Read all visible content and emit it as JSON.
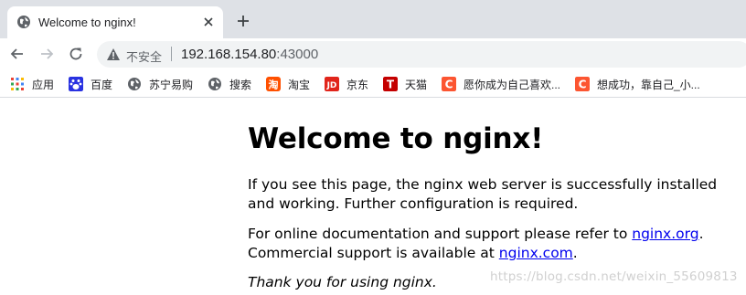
{
  "tab": {
    "title": "Welcome to nginx!"
  },
  "address": {
    "security_label": "不安全",
    "host": "192.168.154.80",
    "port": ":43000"
  },
  "bookmarks": [
    {
      "label": "应用",
      "icon": "apps-grid-icon",
      "color": "#4285f4"
    },
    {
      "label": "百度",
      "icon": "baidu-icon",
      "color": "#2932e1"
    },
    {
      "label": "苏宁易购",
      "icon": "globe-icon",
      "color": "#5f6368"
    },
    {
      "label": "搜索",
      "icon": "globe-icon",
      "color": "#5f6368"
    },
    {
      "label": "淘宝",
      "icon": "taobao-icon",
      "color": "#ff5000"
    },
    {
      "label": "京东",
      "icon": "jd-icon",
      "color": "#e1251b"
    },
    {
      "label": "天猫",
      "icon": "tmall-icon",
      "color": "#c40000"
    },
    {
      "label": "愿你成为自己喜欢...",
      "icon": "csdn-icon",
      "color": "#fc5531"
    },
    {
      "label": "想成功，靠自己_小...",
      "icon": "csdn-icon",
      "color": "#fc5531"
    }
  ],
  "page": {
    "heading": "Welcome to nginx!",
    "p1": "If you see this page, the nginx web server is successfully installed and working. Further configuration is required.",
    "p2_before": "For online documentation and support please refer to ",
    "p2_link1": "nginx.org",
    "p2_mid": ".\nCommercial support is available at ",
    "p2_link2": "nginx.com",
    "p2_after": ".",
    "p3": "Thank you for using nginx."
  },
  "watermark": "https://blog.csdn.net/weixin_55609813",
  "colors": {
    "tabstrip": "#dee1e6",
    "omnibox": "#f1f3f4",
    "link": "#0000ee"
  }
}
